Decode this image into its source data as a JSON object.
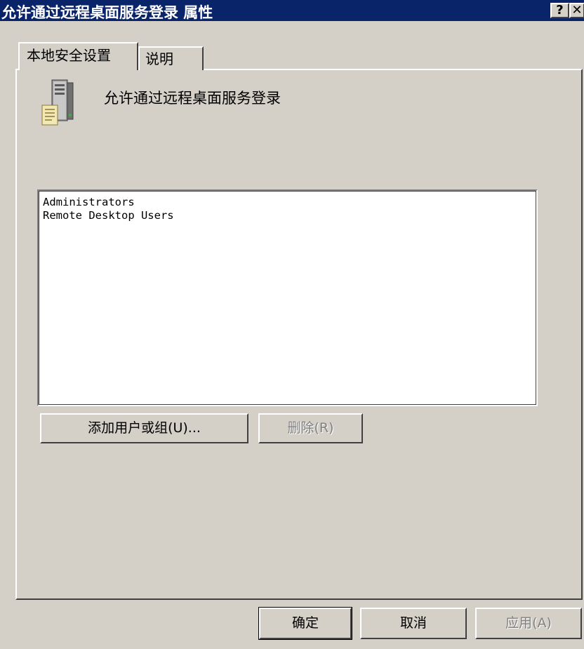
{
  "window": {
    "title": "允许通过远程桌面服务登录 属性",
    "help_label": "?",
    "close_label": "✕"
  },
  "tabs": [
    {
      "label": "本地安全设置",
      "selected": true
    },
    {
      "label": "说明",
      "selected": false
    }
  ],
  "policy": {
    "heading": "允许通过远程桌面服务登录",
    "icon": "server-policy-icon"
  },
  "members": [
    "Administrators",
    "Remote Desktop Users"
  ],
  "buttons": {
    "add": "添加用户或组(U)...",
    "remove": "删除(R)",
    "ok": "确定",
    "cancel": "取消",
    "apply": "应用(A)"
  },
  "colors": {
    "titlebar": "#0a246a",
    "face": "#d4d0c8"
  }
}
